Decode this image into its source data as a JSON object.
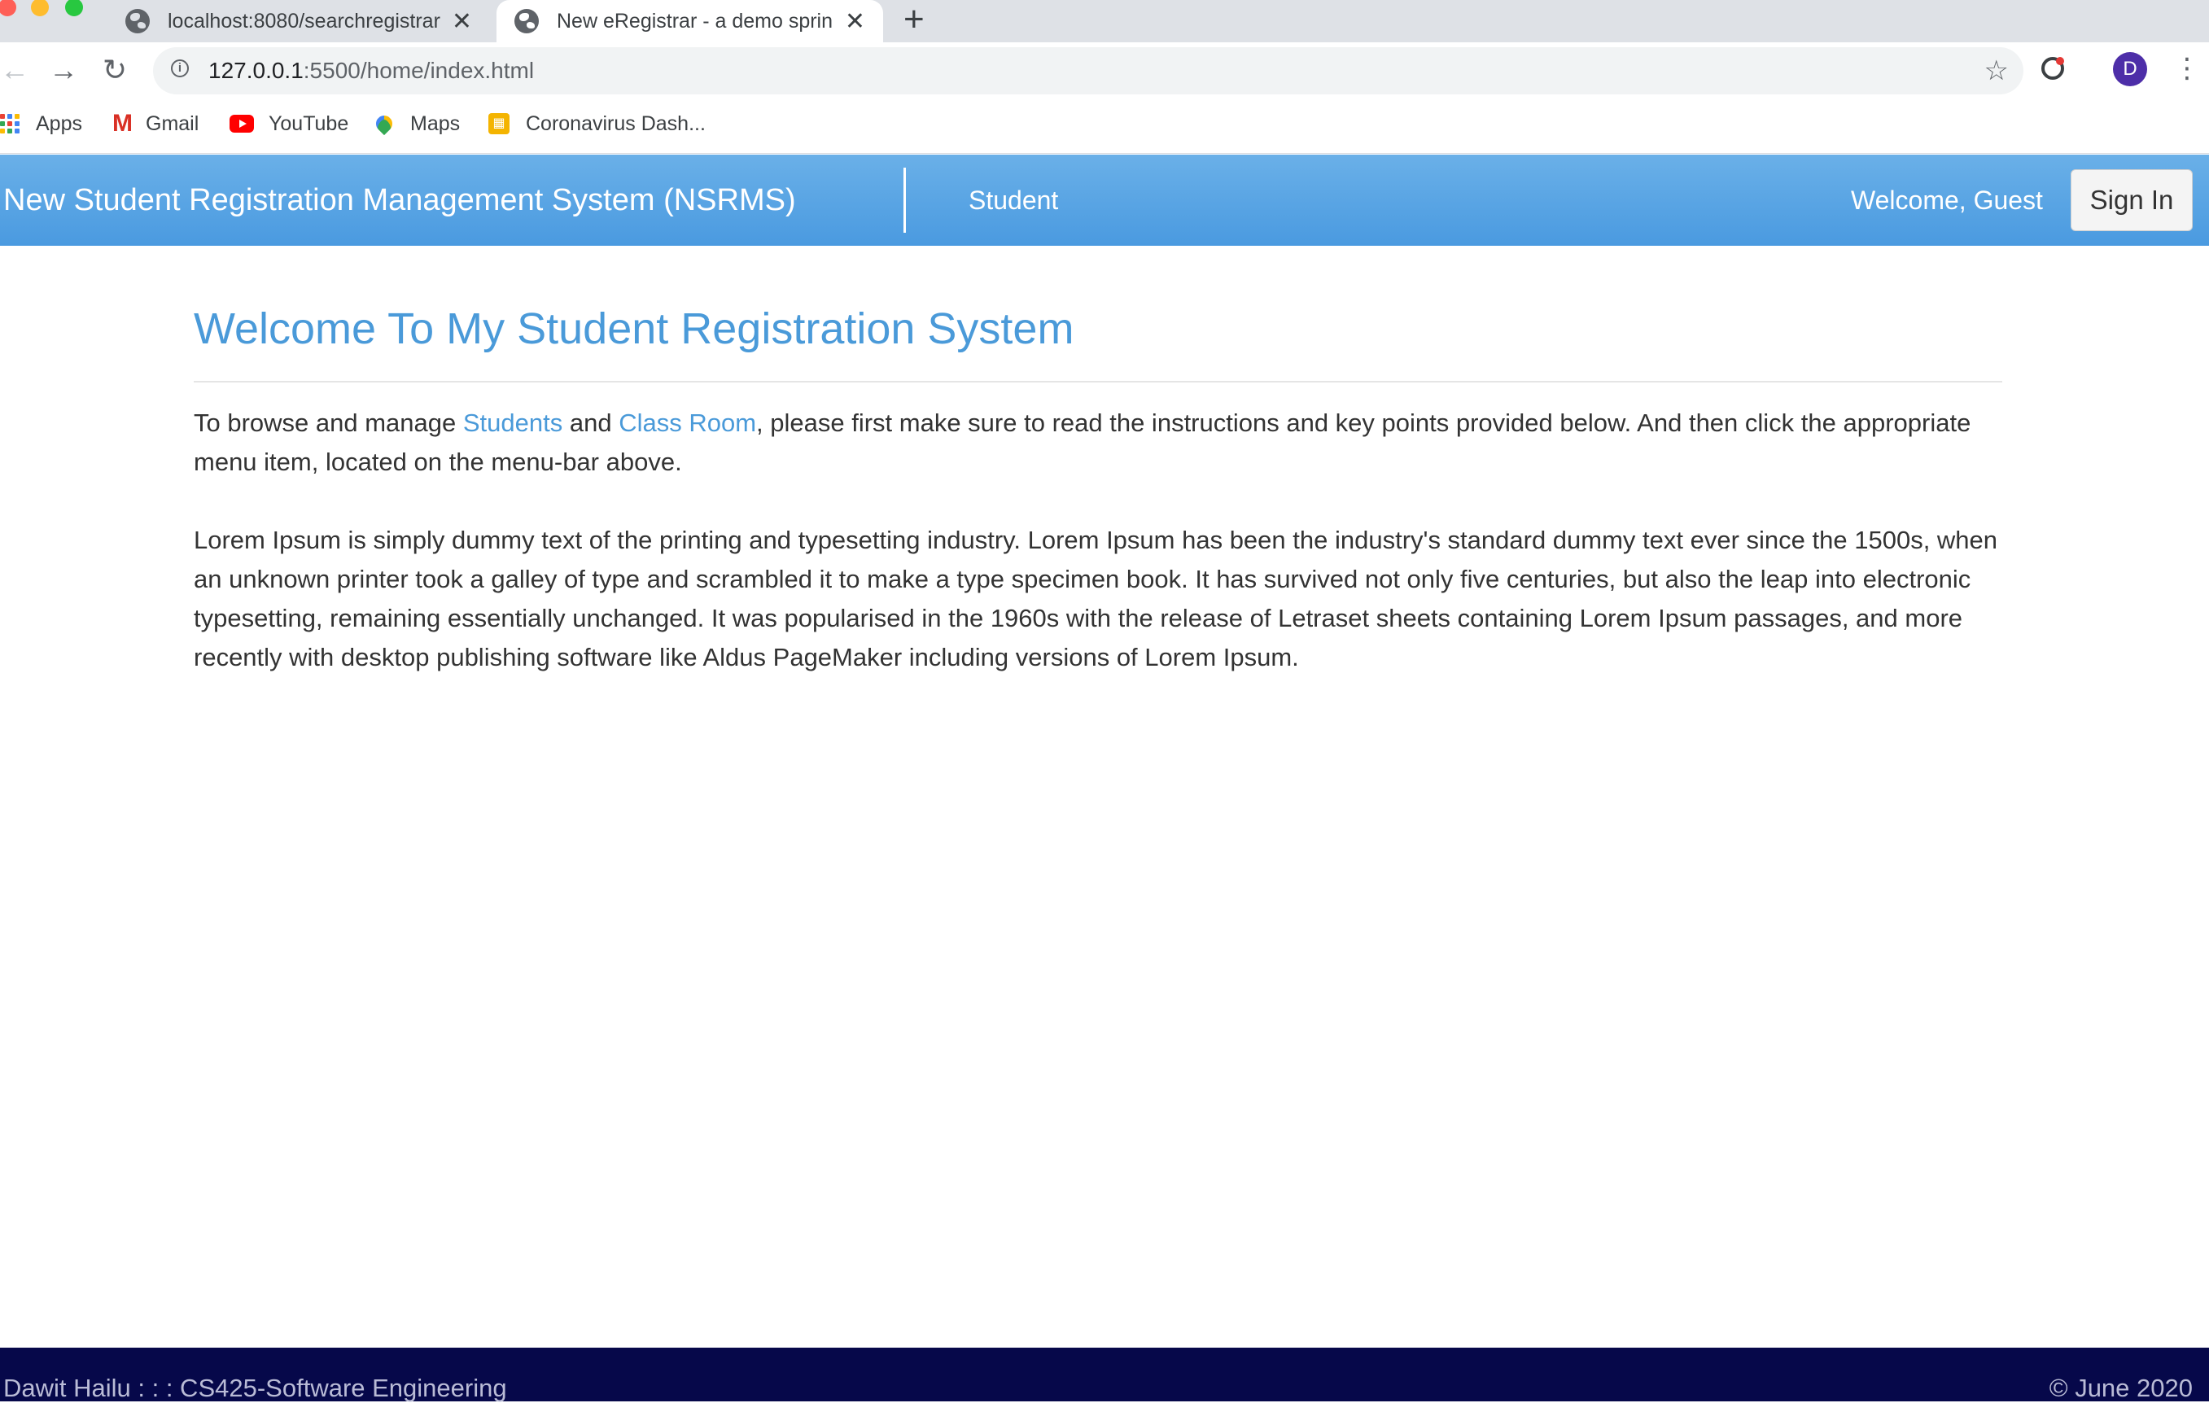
{
  "browser": {
    "tabs": [
      {
        "title": "localhost:8080/searchregistrar",
        "active": false
      },
      {
        "title": "New eRegistrar - a demo spring",
        "active": true
      }
    ],
    "new_tab": "+",
    "close_glyph": "✕",
    "back_glyph": "←",
    "forward_glyph": "→",
    "reload_glyph": "↻",
    "url_host": "127.0.0.1",
    "url_rest": ":5500/home/index.html",
    "star_glyph": "☆",
    "avatar_letter": "D",
    "menu_glyph": "⋮",
    "bookmarks": [
      {
        "label": "Apps",
        "icon": "apps-grid-icon"
      },
      {
        "label": "Gmail",
        "icon": "gmail-icon"
      },
      {
        "label": "YouTube",
        "icon": "youtube-icon"
      },
      {
        "label": "Maps",
        "icon": "maps-icon"
      },
      {
        "label": "Coronavirus Dash...",
        "icon": "dashboard-icon"
      }
    ]
  },
  "navbar": {
    "brand": "New Student Registration Management System (NSRMS)",
    "menu": [
      {
        "label": "Student"
      }
    ],
    "welcome": "Welcome, Guest",
    "signin": "Sign In",
    "colors": {
      "bar_top": "#6ab0e8",
      "bar_bottom": "#4a9ae0"
    }
  },
  "main": {
    "title": "Welcome To My Student Registration System",
    "intro": {
      "before": "To browse and manage ",
      "link1": "Students",
      "middle": " and ",
      "link2": "Class Room",
      "after": ", please first make sure to read the instructions and key points provided below. And then click the appropriate menu item, located on the menu-bar above."
    },
    "lorem": "Lorem Ipsum is simply dummy text of the printing and typesetting industry. Lorem Ipsum has been the industry's standard dummy text ever since the 1500s, when an unknown printer took a galley of type and scrambled it to make a type specimen book. It has survived not only five centuries, but also the leap into electronic typesetting, remaining essentially unchanged. It was popularised in the 1960s with the release of Letraset sheets containing Lorem Ipsum passages, and more recently with desktop publishing software like Aldus PageMaker including versions of Lorem Ipsum."
  },
  "footer": {
    "left": "Dawit Hailu : : : CS425-Software Engineering",
    "right": "© June 2020",
    "bg_color": "#06084a"
  }
}
